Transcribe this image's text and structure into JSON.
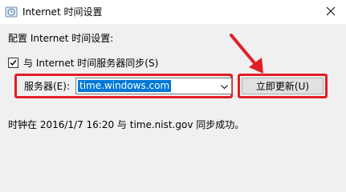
{
  "window": {
    "title": "Internet 时间设置",
    "icon": "clock-globe-icon",
    "close_icon": "close-icon"
  },
  "content": {
    "section_label": "配置 Internet 时间设置:",
    "sync_checkbox": {
      "label": "与 Internet 时间服务器同步(S)",
      "checked": true
    },
    "server": {
      "label": "服务器(E):",
      "value": "time.windows.com"
    },
    "update_button_label": "立即更新(U)",
    "status": "时钟在 2016/1/7 16:20 与 time.nist.gov 同步成功。"
  },
  "colors": {
    "highlight_red": "#e21e26",
    "selection_blue": "#0078d7"
  }
}
